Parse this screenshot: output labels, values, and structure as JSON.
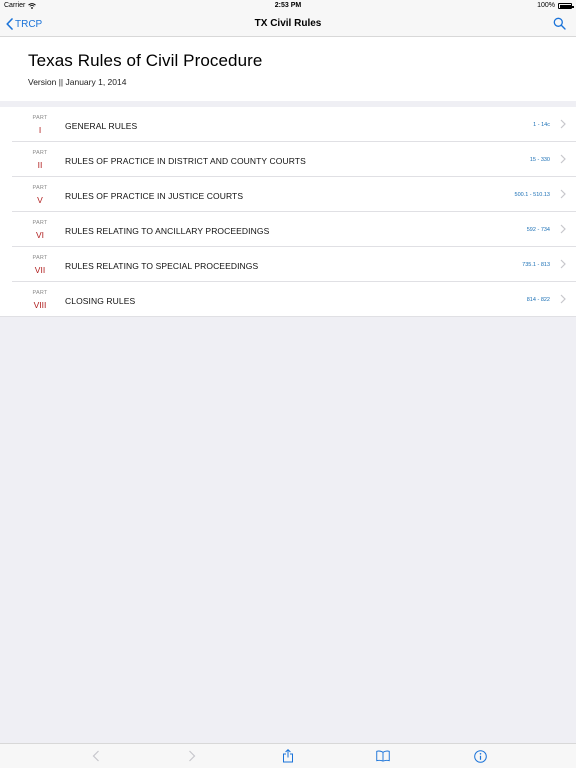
{
  "status_bar": {
    "carrier": "Carrier",
    "time": "2:53 PM",
    "battery": "100%"
  },
  "nav": {
    "back_label": "TRCP",
    "title": "TX Civil Rules"
  },
  "header": {
    "title": "Texas Rules of Civil Procedure",
    "version": "Version || January 1, 2014"
  },
  "parts": [
    {
      "label": "PART",
      "number": "I",
      "title": "GENERAL RULES",
      "range": "1 - 14c"
    },
    {
      "label": "PART",
      "number": "II",
      "title": "RULES OF PRACTICE IN DISTRICT AND COUNTY COURTS",
      "range": "15 - 330"
    },
    {
      "label": "PART",
      "number": "V",
      "title": "RULES OF PRACTICE IN JUSTICE COURTS",
      "range": "500.1 - 510.13"
    },
    {
      "label": "PART",
      "number": "VI",
      "title": "RULES RELATING TO ANCILLARY PROCEEDINGS",
      "range": "592 - 734"
    },
    {
      "label": "PART",
      "number": "VII",
      "title": "RULES RELATING TO SPECIAL PROCEEDINGS",
      "range": "735.1 - 813"
    },
    {
      "label": "PART",
      "number": "VIII",
      "title": "CLOSING RULES",
      "range": "814 - 822"
    }
  ],
  "toolbar": {
    "icons": [
      "back-arrow-icon",
      "forward-arrow-icon",
      "share-icon",
      "book-icon",
      "info-icon"
    ]
  },
  "colors": {
    "accent": "#1a73d9",
    "part_number": "#b01e1e",
    "range": "#1a6fb5",
    "background": "#efeff4"
  }
}
